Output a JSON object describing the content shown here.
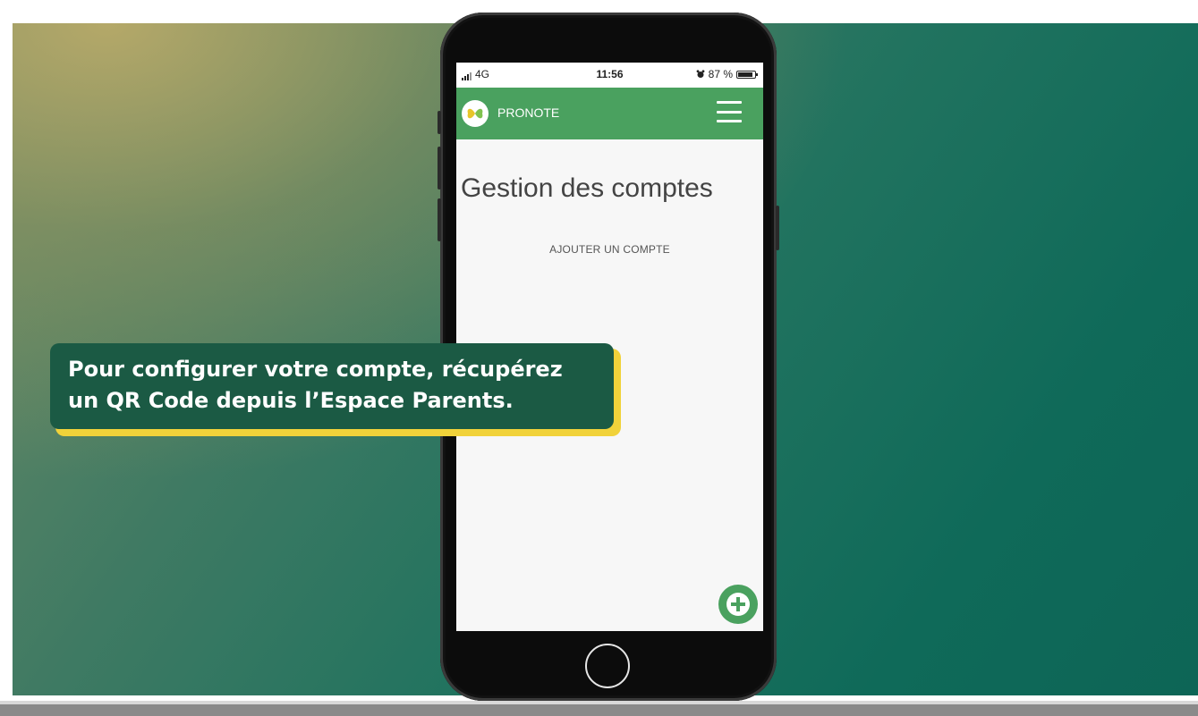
{
  "status_bar": {
    "network": "4G",
    "time": "11:56",
    "battery_text": "87 %",
    "battery_level": 0.87
  },
  "app": {
    "name": "PRONOTE",
    "brand_color": "#4aa15f",
    "menu_icon": "hamburger-icon",
    "logo_icon": "butterfly-logo"
  },
  "main": {
    "title": "Gestion des comptes",
    "add_account_label": "AJOUTER UN COMPTE",
    "fab_icon": "plus-icon"
  },
  "caption": {
    "line1": "Pour configurer votre compte, récupérez",
    "line2": "un QR Code depuis l’Espace Parents.",
    "bg_color": "#1b5a44",
    "accent_color": "#f1d23a"
  }
}
